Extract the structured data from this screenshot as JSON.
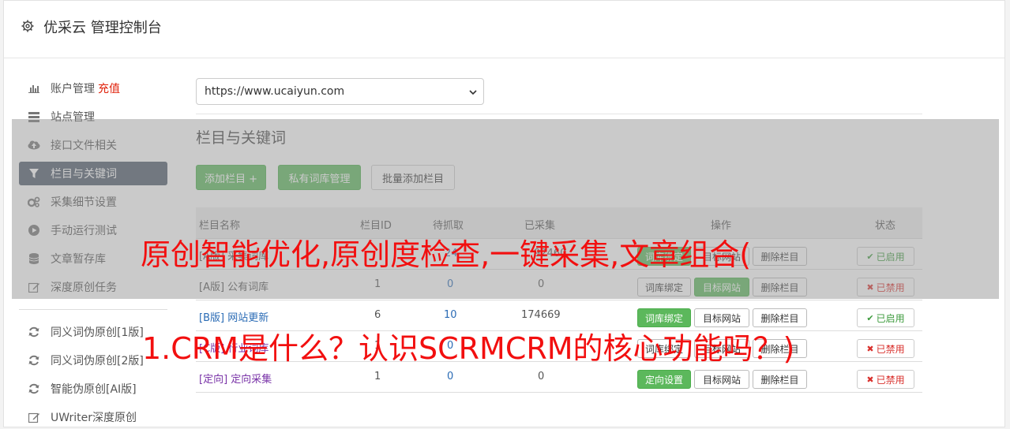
{
  "app": {
    "title": "优采云 管理控制台"
  },
  "sidebar": {
    "items": [
      {
        "label": "账户管理",
        "extra": "充值",
        "icon": "bar-chart-icon"
      },
      {
        "label": "站点管理",
        "icon": "server-icon"
      },
      {
        "label": "接口文件相关",
        "icon": "cloud-upload-icon"
      },
      {
        "label": "栏目与关键词",
        "icon": "filter-icon",
        "active": true
      },
      {
        "label": "采集细节设置",
        "icon": "cogs-icon"
      },
      {
        "label": "手动运行测试",
        "icon": "play-circle-icon"
      },
      {
        "label": "文章暂存库",
        "icon": "database-icon"
      },
      {
        "label": "深度原创任务",
        "icon": "edit-icon"
      },
      {
        "label": "同义词伪原创[1版]",
        "icon": "refresh-icon"
      },
      {
        "label": "同义词伪原创[2版]",
        "icon": "refresh-icon"
      },
      {
        "label": "智能伪原创[AI版]",
        "icon": "refresh-icon"
      },
      {
        "label": "UWriter深度原创",
        "icon": "edit-icon"
      }
    ]
  },
  "site_select": {
    "value": "https://www.ucaiyun.com"
  },
  "section": {
    "title": "栏目与关键词",
    "add_label": "添加栏目 +",
    "private_label": "私有词库管理",
    "batch_label": "批量添加栏目"
  },
  "table": {
    "headers": [
      "栏目名称",
      "栏目ID",
      "待抓取",
      "已采集",
      "操作",
      "状态"
    ],
    "rows": [
      {
        "name": "[A版] 采集词库",
        "id": "",
        "pending": "24",
        "collected": "92460",
        "bind": "词库绑定",
        "target": "目标网站",
        "delete": "删除栏目",
        "status": "已启用"
      },
      {
        "name": "[A版] 公有词库",
        "id": "1",
        "pending": "0",
        "collected": "0",
        "bind": "词库绑定",
        "target": "目标网站",
        "delete": "删除栏目",
        "status": "已禁用"
      },
      {
        "name": "[B版] 网站更新",
        "id": "6",
        "pending": "10",
        "collected": "174669",
        "bind": "词库绑定",
        "target": "目标网站",
        "delete": "删除栏目",
        "status": "已启用"
      },
      {
        "name": "[C版] 行业词库",
        "id": "1",
        "pending": "0",
        "collected": "",
        "bind": "词库绑定",
        "target": "目标网站",
        "delete": "删除栏目",
        "status": "已禁用"
      },
      {
        "name": "[定向] 定向采集",
        "id": "1",
        "pending": "0",
        "collected": "0",
        "bind": "定向设置",
        "target": "目标网站",
        "delete": "删除栏目",
        "status": "已禁用"
      }
    ]
  },
  "watermark": {
    "line1": "原创智能优化,原创度检查,一键采集,文章组合(",
    "line2": "1.CRM是什么？认识SCRMCRM的核心功能吗？)"
  },
  "colors": {
    "accent_green": "#5cb85c",
    "sidebar_active": "#4e5a6b",
    "watermark_red": "#f20f0f"
  }
}
